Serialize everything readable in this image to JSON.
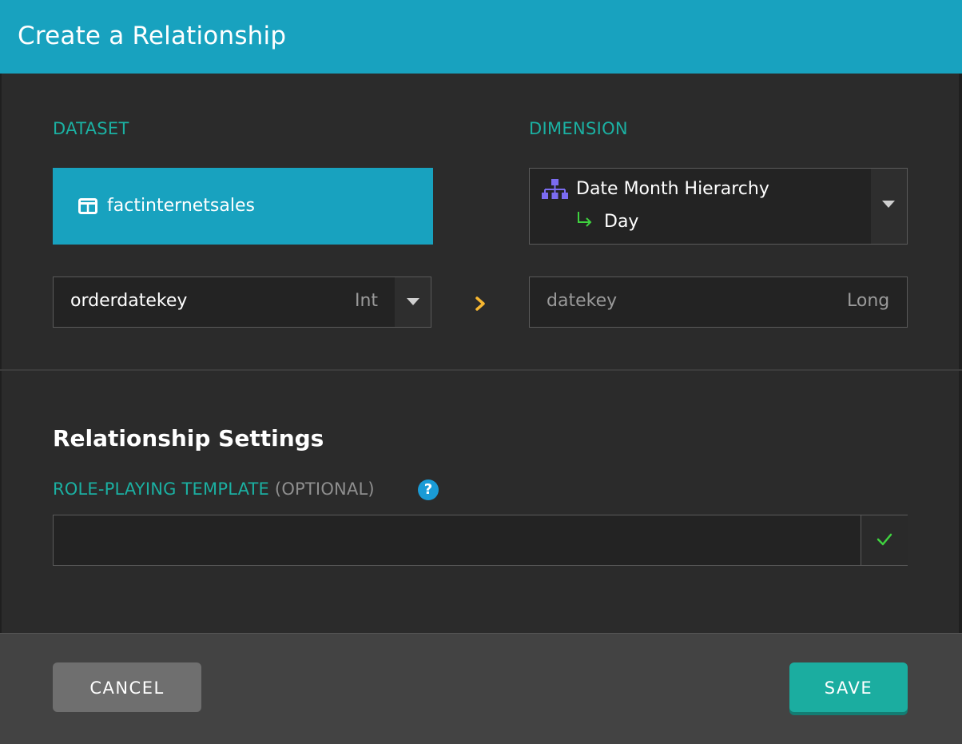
{
  "header": {
    "title": "Create a Relationship"
  },
  "dataset": {
    "label": "DATASET",
    "name": "factinternetsales",
    "icon": "table-icon",
    "field": {
      "value": "orderdatekey",
      "type": "Int"
    }
  },
  "dimension": {
    "label": "DIMENSION",
    "hierarchy": "Date Month Hierarchy",
    "level": "Day",
    "hierarchy_icon": "hierarchy-icon",
    "level_icon": "return-arrow-icon",
    "field": {
      "value": "datekey",
      "type": "Long"
    }
  },
  "settings": {
    "title": "Relationship Settings",
    "template_label": "ROLE-PLAYING TEMPLATE",
    "template_optional": "(OPTIONAL)",
    "help_glyph": "?",
    "template_value": "",
    "template_placeholder": ""
  },
  "footer": {
    "cancel_label": "CANCEL",
    "save_label": "SAVE"
  },
  "colors": {
    "header": "#18a2bf",
    "accent_teal": "#1bb0a2",
    "save": "#1bada0",
    "hierarchy_icon": "#7b6cf0",
    "level_arrow": "#3fd23f",
    "map_arrow": "#f7b731",
    "help": "#1a9bd6"
  }
}
